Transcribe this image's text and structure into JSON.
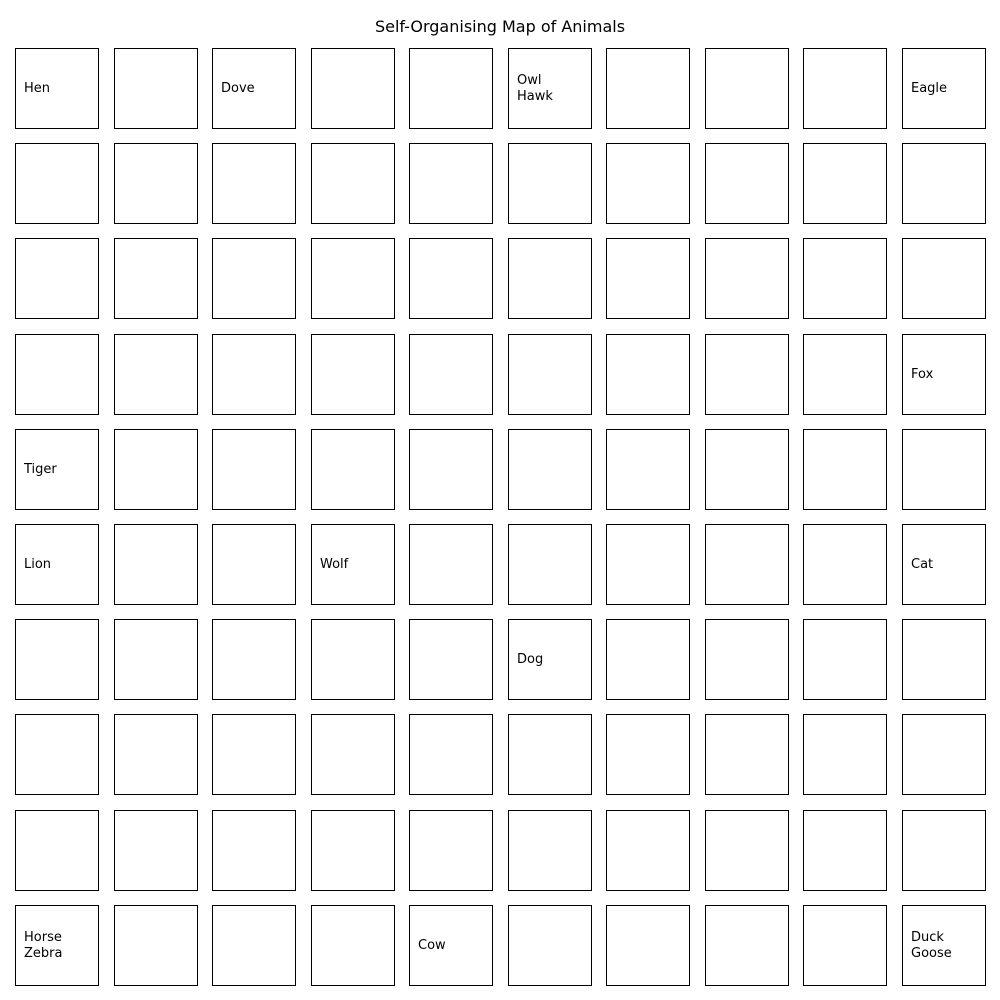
{
  "title": "Self-Organising Map of Animals",
  "grid": {
    "rows": 10,
    "cols": 10
  },
  "cells": [
    {
      "row": 0,
      "col": 0,
      "labels": [
        "Hen"
      ]
    },
    {
      "row": 0,
      "col": 2,
      "labels": [
        "Dove"
      ]
    },
    {
      "row": 0,
      "col": 5,
      "labels": [
        "Owl",
        "Hawk"
      ]
    },
    {
      "row": 0,
      "col": 9,
      "labels": [
        "Eagle"
      ]
    },
    {
      "row": 3,
      "col": 9,
      "labels": [
        "Fox"
      ]
    },
    {
      "row": 4,
      "col": 0,
      "labels": [
        "Tiger"
      ]
    },
    {
      "row": 5,
      "col": 0,
      "labels": [
        "Lion"
      ]
    },
    {
      "row": 5,
      "col": 3,
      "labels": [
        "Wolf"
      ]
    },
    {
      "row": 5,
      "col": 9,
      "labels": [
        "Cat"
      ]
    },
    {
      "row": 6,
      "col": 5,
      "labels": [
        "Dog"
      ]
    },
    {
      "row": 9,
      "col": 0,
      "labels": [
        "Horse",
        "Zebra"
      ]
    },
    {
      "row": 9,
      "col": 4,
      "labels": [
        "Cow"
      ]
    },
    {
      "row": 9,
      "col": 9,
      "labels": [
        "Duck",
        "Goose"
      ]
    }
  ]
}
